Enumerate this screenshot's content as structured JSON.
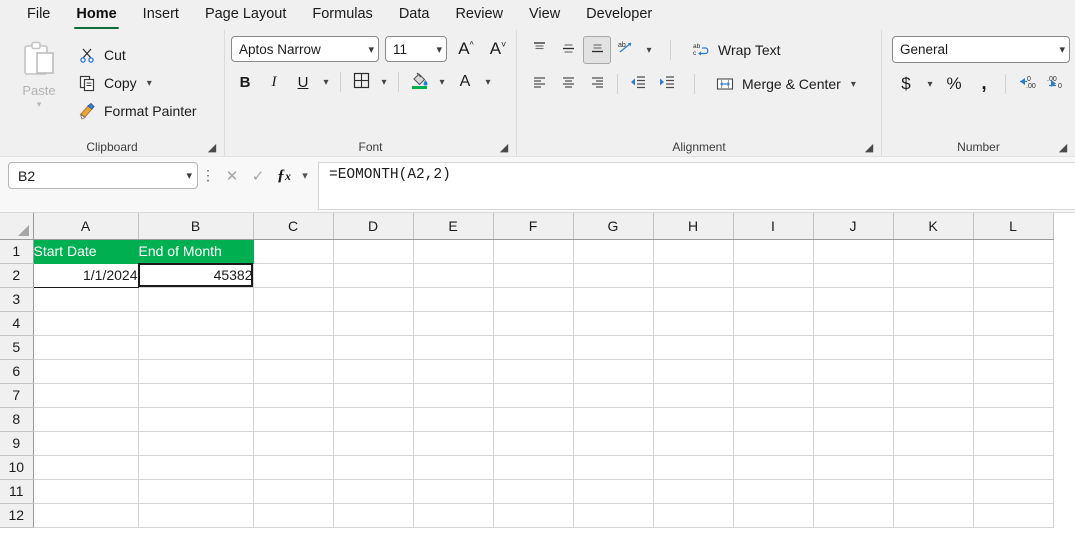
{
  "ribbon": {
    "tabs": [
      {
        "label": "File",
        "active": false
      },
      {
        "label": "Home",
        "active": true
      },
      {
        "label": "Insert",
        "active": false
      },
      {
        "label": "Page Layout",
        "active": false
      },
      {
        "label": "Formulas",
        "active": false
      },
      {
        "label": "Data",
        "active": false
      },
      {
        "label": "Review",
        "active": false
      },
      {
        "label": "View",
        "active": false
      },
      {
        "label": "Developer",
        "active": false
      }
    ],
    "accent_color": "#0f6c3d",
    "clipboard": {
      "label": "Clipboard",
      "paste_label": "Paste",
      "paste_disabled": true,
      "cut_label": "Cut",
      "copy_label": "Copy",
      "format_painter_label": "Format Painter"
    },
    "font": {
      "label": "Font",
      "font_name": "Aptos Narrow",
      "font_size": "11",
      "grow_font": "A",
      "shrink_font": "A",
      "bold": "B",
      "italic": "I",
      "underline": "U",
      "fill_color": "#00b050"
    },
    "alignment": {
      "label": "Alignment",
      "wrap_text_label": "Wrap Text",
      "merge_center_label": "Merge & Center",
      "vertical_selected": "bottom-align"
    },
    "number": {
      "label": "Number",
      "format": "General",
      "currency": "$",
      "percent": "%",
      "comma": ",",
      "increase_decimal": ".00",
      "decrease_decimal": ".00"
    }
  },
  "formula_bar": {
    "name_box": "B2",
    "formula": "=EOMONTH(A2,2)"
  },
  "sheet": {
    "columns": [
      "A",
      "B",
      "C",
      "D",
      "E",
      "F",
      "G",
      "H",
      "I",
      "J",
      "K",
      "L"
    ],
    "rows": [
      "1",
      "2",
      "3",
      "4",
      "5",
      "6",
      "7",
      "8",
      "9",
      "10",
      "11",
      "12"
    ],
    "cells": {
      "A1": "Start Date",
      "B1": "End of Month",
      "A2": "1/1/2024",
      "B2": "45382"
    },
    "selected_cell": "B2",
    "header_fill": "#00b050",
    "header_text_color": "#ffffff"
  }
}
